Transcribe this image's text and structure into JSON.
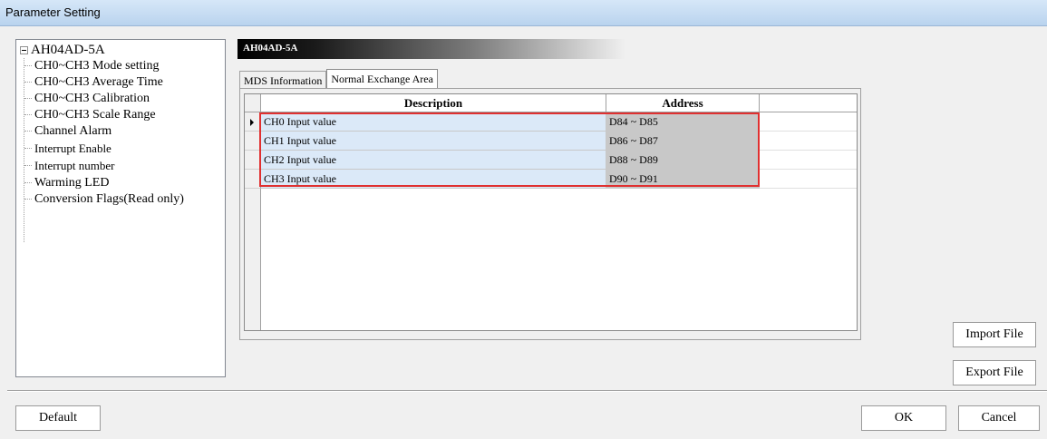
{
  "window": {
    "title": "Parameter Setting"
  },
  "tree": {
    "root": "AH04AD-5A",
    "items": [
      "CH0~CH3 Mode setting",
      "CH0~CH3 Average Time",
      "CH0~CH3 Calibration",
      "CH0~CH3 Scale Range",
      "Channel Alarm",
      "Interrupt Enable",
      "Interrupt number",
      "Warming LED",
      "Conversion Flags(Read only)"
    ]
  },
  "header": {
    "module_label": "AH04AD-5A"
  },
  "tabs": [
    {
      "label": "MDS Information",
      "active": false
    },
    {
      "label": "Normal Exchange Area",
      "active": true
    }
  ],
  "grid": {
    "columns": [
      "Description",
      "Address"
    ],
    "rows": [
      {
        "description": "CH0 Input value",
        "address": "D84 ~ D85"
      },
      {
        "description": "CH1 Input value",
        "address": "D86 ~ D87"
      },
      {
        "description": "CH2 Input value",
        "address": "D88 ~ D89"
      },
      {
        "description": "CH3 Input value",
        "address": "D90 ~ D91"
      }
    ]
  },
  "buttons": {
    "import": "Import File",
    "export": "Export File",
    "default": "Default",
    "ok": "OK",
    "cancel": "Cancel"
  },
  "colors": {
    "highlight": "#e03030",
    "selected_row": "#dbe9f8",
    "address_cell": "#c8c8c8"
  }
}
